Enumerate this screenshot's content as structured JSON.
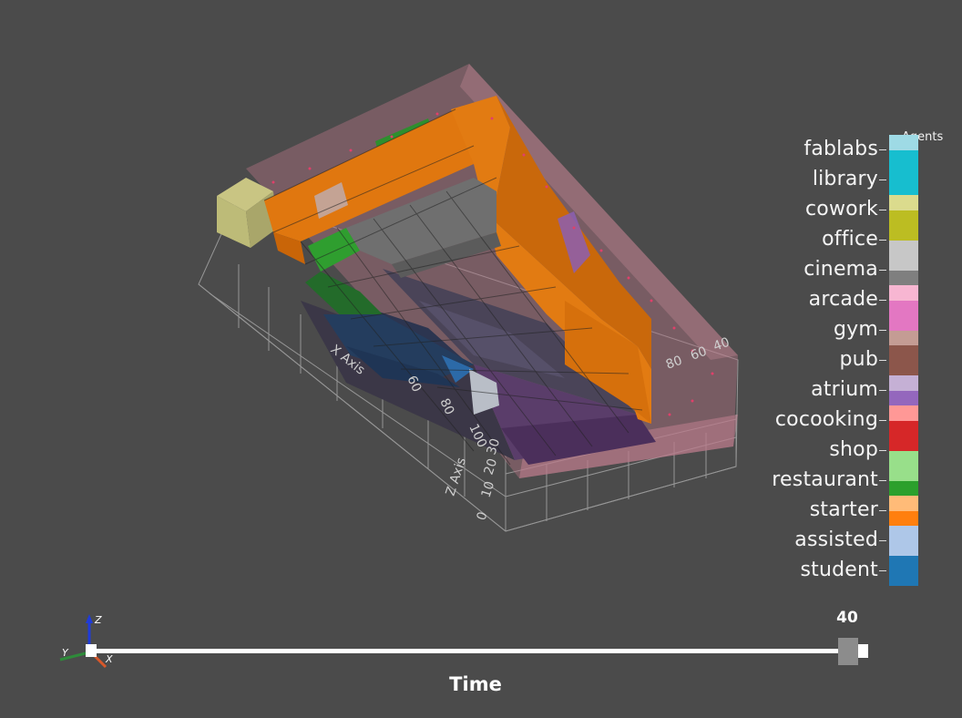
{
  "viewport": {
    "axes": {
      "x_title": "X Axis",
      "z_title": "Z Axis",
      "x_ticks": [
        "60",
        "80",
        "100"
      ],
      "y_ticks": [
        "80",
        "60",
        "40"
      ],
      "z_ticks": [
        "0",
        "10",
        "20",
        "30"
      ]
    },
    "orientation_widget": {
      "x": "X",
      "y": "Y",
      "z": "Z"
    }
  },
  "legend": {
    "title": "Agents",
    "items": [
      {
        "label": "fablabs",
        "colors": [
          "#9edae5",
          "#17becf"
        ]
      },
      {
        "label": "library",
        "colors": [
          "#17becf",
          "#17becf"
        ]
      },
      {
        "label": "cowork",
        "colors": [
          "#dbdb8d",
          "#bcbd22"
        ]
      },
      {
        "label": "office",
        "colors": [
          "#bcbd22",
          "#c7c7c7"
        ]
      },
      {
        "label": "cinema",
        "colors": [
          "#c7c7c7",
          "#7f7f7f"
        ]
      },
      {
        "label": "arcade",
        "colors": [
          "#f7b6d2",
          "#e377c2"
        ]
      },
      {
        "label": "gym",
        "colors": [
          "#e377c2",
          "#c49c94"
        ]
      },
      {
        "label": "pub",
        "colors": [
          "#8c564b",
          "#8c564b"
        ]
      },
      {
        "label": "atrium",
        "colors": [
          "#c5b0d5",
          "#9467bd"
        ]
      },
      {
        "label": "cocooking",
        "colors": [
          "#ff9896",
          "#d62728"
        ]
      },
      {
        "label": "shop",
        "colors": [
          "#d62728",
          "#98df8a"
        ]
      },
      {
        "label": "restaurant",
        "colors": [
          "#98df8a",
          "#2ca02c"
        ]
      },
      {
        "label": "starter",
        "colors": [
          "#ffbb78",
          "#ff7f0e"
        ]
      },
      {
        "label": "assisted",
        "colors": [
          "#aec7e8",
          "#aec7e8"
        ]
      },
      {
        "label": "student",
        "colors": [
          "#1f77b4",
          "#1f77b4"
        ]
      }
    ]
  },
  "slider": {
    "label": "Time",
    "value": "40",
    "fraction": 1.0,
    "track_color": "#ffffff",
    "handle_color": "#8c8c8c"
  }
}
